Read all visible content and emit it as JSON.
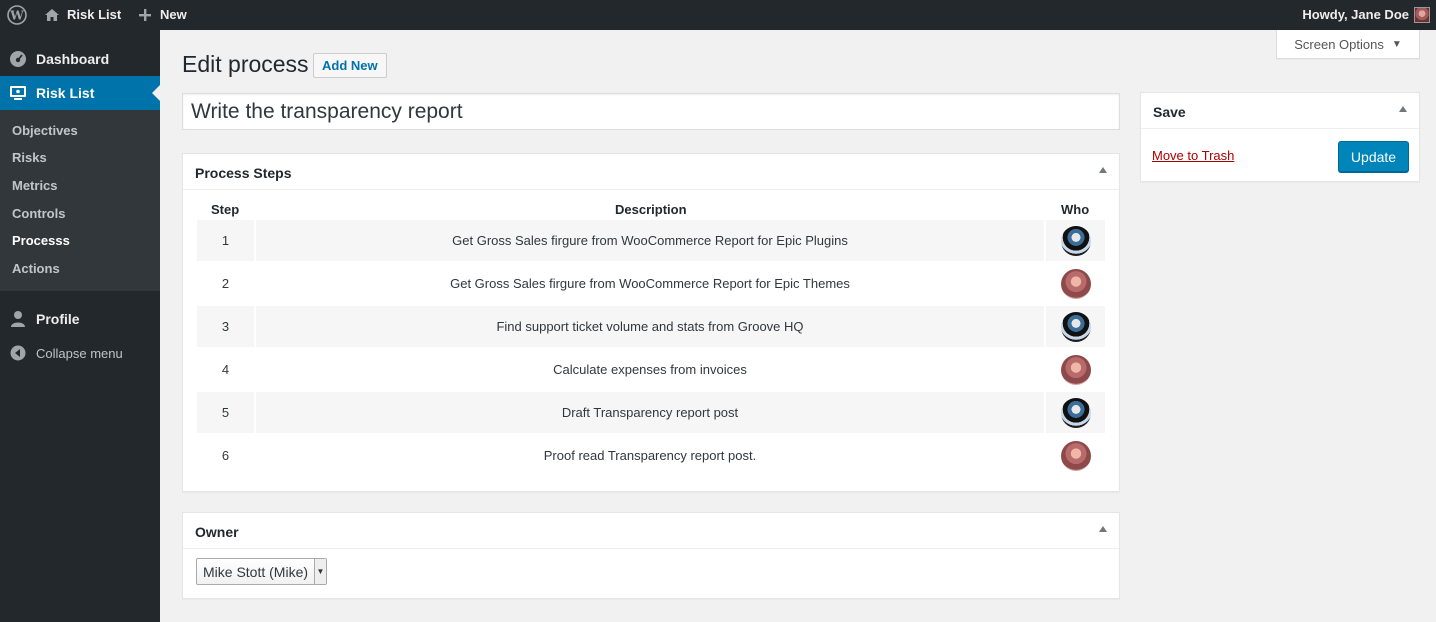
{
  "adminbar": {
    "site_name": "Risk List",
    "new_label": "New",
    "howdy": "Howdy, Jane Doe"
  },
  "sidebar": {
    "dashboard": "Dashboard",
    "risk_list": "Risk List",
    "submenu": [
      {
        "label": "Objectives"
      },
      {
        "label": "Risks"
      },
      {
        "label": "Metrics"
      },
      {
        "label": "Controls"
      },
      {
        "label": "Processs"
      },
      {
        "label": "Actions"
      }
    ],
    "profile": "Profile",
    "collapse": "Collapse menu"
  },
  "screen_options": "Screen Options",
  "heading": {
    "title": "Edit process",
    "add_new": "Add New"
  },
  "post_title": "Write the transparency report",
  "steps_box": {
    "title": "Process Steps",
    "columns": {
      "step": "Step",
      "description": "Description",
      "who": "Who"
    },
    "rows": [
      {
        "step": "1",
        "description": "Get Gross Sales firgure from WooCommerce Report for Epic Plugins",
        "who": "mike"
      },
      {
        "step": "2",
        "description": "Get Gross Sales firgure from WooCommerce Report for Epic Themes",
        "who": "jane"
      },
      {
        "step": "3",
        "description": "Find support ticket volume and stats from Groove HQ",
        "who": "mike"
      },
      {
        "step": "4",
        "description": "Calculate expenses from invoices",
        "who": "jane"
      },
      {
        "step": "5",
        "description": "Draft Transparency report post",
        "who": "mike"
      },
      {
        "step": "6",
        "description": "Proof read Transparency report post.",
        "who": "jane"
      }
    ]
  },
  "owner_box": {
    "title": "Owner",
    "selected": "Mike Stott (Mike)"
  },
  "save_box": {
    "title": "Save",
    "trash_label": "Move to Trash",
    "update_label": "Update"
  },
  "colors": {
    "admin_bg": "#23282d",
    "accent": "#0073aa",
    "button_primary": "#0085ba",
    "trash": "#a00"
  }
}
